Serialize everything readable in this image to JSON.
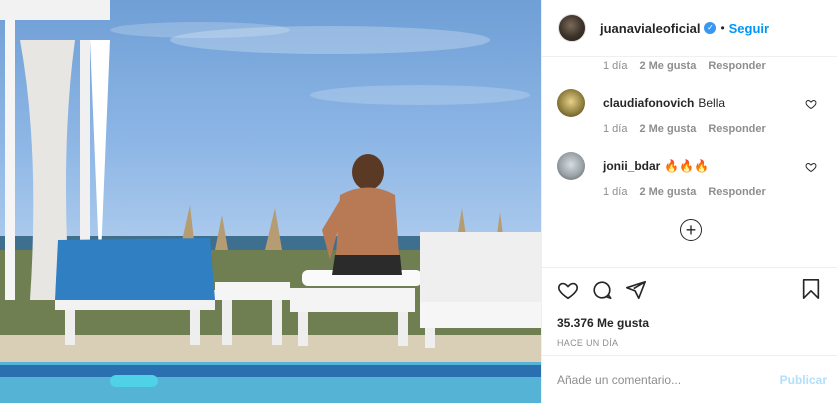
{
  "post": {
    "image_alt": "Woman sitting on a sun lounger by a pool facing the sea"
  },
  "header": {
    "username": "juanavialeoficial",
    "verified_glyph": "✓",
    "separator": "•",
    "follow_label": "Seguir"
  },
  "comments": {
    "top_meta": {
      "time": "1 día",
      "likes": "2 Me gusta",
      "reply": "Responder"
    },
    "items": [
      {
        "username": "claudiafonovich",
        "text": "Bella",
        "time": "1 día",
        "likes": "2 Me gusta",
        "reply": "Responder",
        "avatar_color": "#c9b35a"
      },
      {
        "username": "jonii_bdar",
        "text": "🔥🔥🔥",
        "time": "1 día",
        "likes": "2 Me gusta",
        "reply": "Responder",
        "avatar_color": "#9aa3a8"
      }
    ],
    "load_more_glyph": "+"
  },
  "actions": {
    "like_icon": "heart-icon",
    "comment_icon": "comment-icon",
    "share_icon": "share-icon",
    "save_icon": "bookmark-icon",
    "likes_count": "35.376 Me gusta",
    "time_ago": "HACE UN DÍA"
  },
  "add_comment": {
    "placeholder": "Añade un comentario...",
    "publish_label": "Publicar"
  },
  "colors": {
    "accent": "#0095f6",
    "publish_disabled": "#b2dffc",
    "secondary_text": "#8e8e8e"
  }
}
